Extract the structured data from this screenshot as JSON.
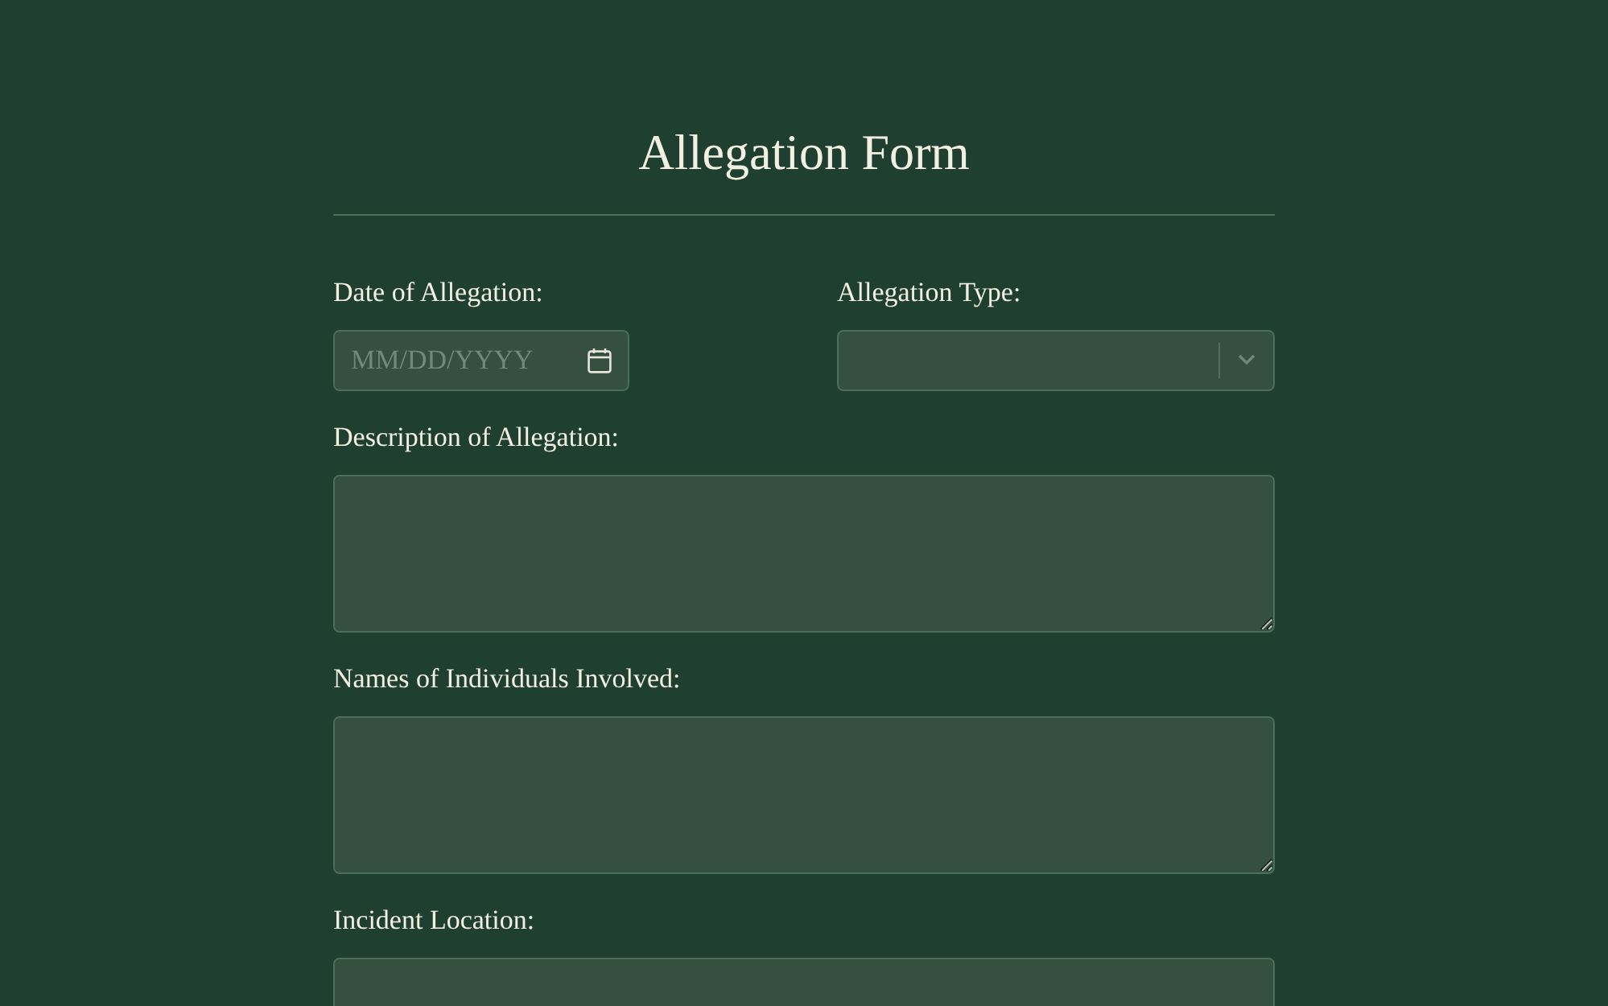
{
  "title": "Allegation Form",
  "rows": [
    [
      {
        "kind": "date",
        "label": "Date of Allegation:",
        "placeholder": "MM/DD/YYYY"
      },
      {
        "kind": "select",
        "label": "Allegation Type:"
      }
    ],
    [
      {
        "kind": "textarea",
        "label": "Description of Allegation:"
      }
    ],
    [
      {
        "kind": "textarea",
        "label": "Names of Individuals Involved:"
      }
    ],
    [
      {
        "kind": "text",
        "label": "Incident Location:"
      }
    ]
  ]
}
